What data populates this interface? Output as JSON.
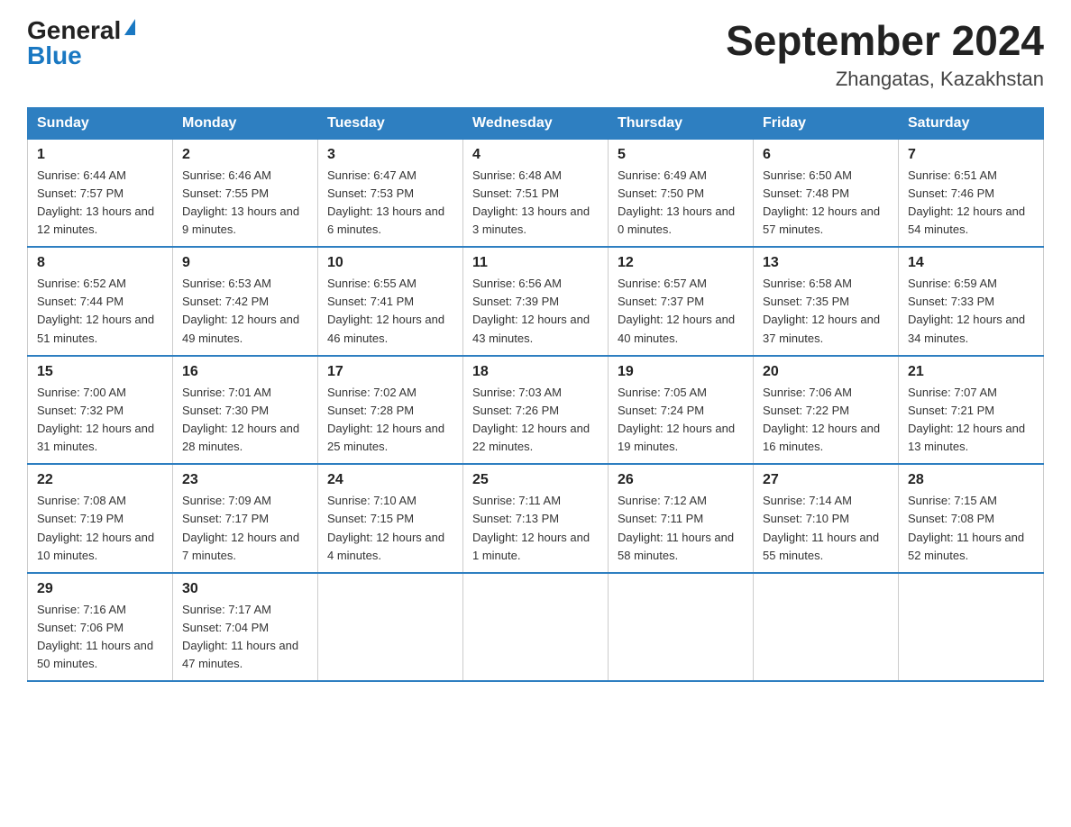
{
  "header": {
    "logo_general": "General",
    "logo_blue": "Blue",
    "month_title": "September 2024",
    "location": "Zhangatas, Kazakhstan"
  },
  "weekdays": [
    "Sunday",
    "Monday",
    "Tuesday",
    "Wednesday",
    "Thursday",
    "Friday",
    "Saturday"
  ],
  "weeks": [
    [
      {
        "day": "1",
        "sunrise": "6:44 AM",
        "sunset": "7:57 PM",
        "daylight": "13 hours and 12 minutes."
      },
      {
        "day": "2",
        "sunrise": "6:46 AM",
        "sunset": "7:55 PM",
        "daylight": "13 hours and 9 minutes."
      },
      {
        "day": "3",
        "sunrise": "6:47 AM",
        "sunset": "7:53 PM",
        "daylight": "13 hours and 6 minutes."
      },
      {
        "day": "4",
        "sunrise": "6:48 AM",
        "sunset": "7:51 PM",
        "daylight": "13 hours and 3 minutes."
      },
      {
        "day": "5",
        "sunrise": "6:49 AM",
        "sunset": "7:50 PM",
        "daylight": "13 hours and 0 minutes."
      },
      {
        "day": "6",
        "sunrise": "6:50 AM",
        "sunset": "7:48 PM",
        "daylight": "12 hours and 57 minutes."
      },
      {
        "day": "7",
        "sunrise": "6:51 AM",
        "sunset": "7:46 PM",
        "daylight": "12 hours and 54 minutes."
      }
    ],
    [
      {
        "day": "8",
        "sunrise": "6:52 AM",
        "sunset": "7:44 PM",
        "daylight": "12 hours and 51 minutes."
      },
      {
        "day": "9",
        "sunrise": "6:53 AM",
        "sunset": "7:42 PM",
        "daylight": "12 hours and 49 minutes."
      },
      {
        "day": "10",
        "sunrise": "6:55 AM",
        "sunset": "7:41 PM",
        "daylight": "12 hours and 46 minutes."
      },
      {
        "day": "11",
        "sunrise": "6:56 AM",
        "sunset": "7:39 PM",
        "daylight": "12 hours and 43 minutes."
      },
      {
        "day": "12",
        "sunrise": "6:57 AM",
        "sunset": "7:37 PM",
        "daylight": "12 hours and 40 minutes."
      },
      {
        "day": "13",
        "sunrise": "6:58 AM",
        "sunset": "7:35 PM",
        "daylight": "12 hours and 37 minutes."
      },
      {
        "day": "14",
        "sunrise": "6:59 AM",
        "sunset": "7:33 PM",
        "daylight": "12 hours and 34 minutes."
      }
    ],
    [
      {
        "day": "15",
        "sunrise": "7:00 AM",
        "sunset": "7:32 PM",
        "daylight": "12 hours and 31 minutes."
      },
      {
        "day": "16",
        "sunrise": "7:01 AM",
        "sunset": "7:30 PM",
        "daylight": "12 hours and 28 minutes."
      },
      {
        "day": "17",
        "sunrise": "7:02 AM",
        "sunset": "7:28 PM",
        "daylight": "12 hours and 25 minutes."
      },
      {
        "day": "18",
        "sunrise": "7:03 AM",
        "sunset": "7:26 PM",
        "daylight": "12 hours and 22 minutes."
      },
      {
        "day": "19",
        "sunrise": "7:05 AM",
        "sunset": "7:24 PM",
        "daylight": "12 hours and 19 minutes."
      },
      {
        "day": "20",
        "sunrise": "7:06 AM",
        "sunset": "7:22 PM",
        "daylight": "12 hours and 16 minutes."
      },
      {
        "day": "21",
        "sunrise": "7:07 AM",
        "sunset": "7:21 PM",
        "daylight": "12 hours and 13 minutes."
      }
    ],
    [
      {
        "day": "22",
        "sunrise": "7:08 AM",
        "sunset": "7:19 PM",
        "daylight": "12 hours and 10 minutes."
      },
      {
        "day": "23",
        "sunrise": "7:09 AM",
        "sunset": "7:17 PM",
        "daylight": "12 hours and 7 minutes."
      },
      {
        "day": "24",
        "sunrise": "7:10 AM",
        "sunset": "7:15 PM",
        "daylight": "12 hours and 4 minutes."
      },
      {
        "day": "25",
        "sunrise": "7:11 AM",
        "sunset": "7:13 PM",
        "daylight": "12 hours and 1 minute."
      },
      {
        "day": "26",
        "sunrise": "7:12 AM",
        "sunset": "7:11 PM",
        "daylight": "11 hours and 58 minutes."
      },
      {
        "day": "27",
        "sunrise": "7:14 AM",
        "sunset": "7:10 PM",
        "daylight": "11 hours and 55 minutes."
      },
      {
        "day": "28",
        "sunrise": "7:15 AM",
        "sunset": "7:08 PM",
        "daylight": "11 hours and 52 minutes."
      }
    ],
    [
      {
        "day": "29",
        "sunrise": "7:16 AM",
        "sunset": "7:06 PM",
        "daylight": "11 hours and 50 minutes."
      },
      {
        "day": "30",
        "sunrise": "7:17 AM",
        "sunset": "7:04 PM",
        "daylight": "11 hours and 47 minutes."
      },
      null,
      null,
      null,
      null,
      null
    ]
  ]
}
